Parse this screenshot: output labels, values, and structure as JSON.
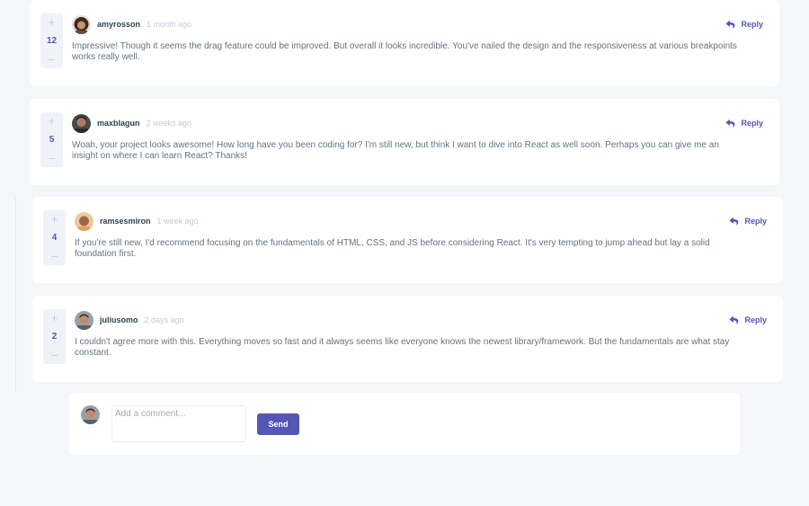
{
  "comments": [
    {
      "username": "amyrosson",
      "time": "1 month ago",
      "score": "12",
      "content": "Impressive! Though it seems the drag feature could be improved. But overall it looks incredible. You've nailed the design and the responsiveness at various breakpoints works really well.",
      "reply_label": "Reply"
    },
    {
      "username": "maxblagun",
      "time": "2 weeks ago",
      "score": "5",
      "content": "Woah, your project looks awesome! How long have you been coding for? I'm still new, but think I want to dive into React as well soon. Perhaps you can give me an insight on where I can learn React? Thanks!",
      "reply_label": "Reply"
    },
    {
      "username": "ramsesmiron",
      "time": "1 week ago",
      "score": "4",
      "content": "If you're still new, I'd recommend focusing on the fundamentals of HTML, CSS, and JS before considering React. It's very tempting to jump ahead but lay a solid foundation first.",
      "reply_label": "Reply"
    },
    {
      "username": "juliusomo",
      "time": "2 days ago",
      "score": "2",
      "content": "I couldn't agree more with this. Everything moves so fast and it always seems like everyone knows the newest library/framework. But the fundamentals are what stay constant.",
      "reply_label": "Reply"
    }
  ],
  "vote": {
    "plus": "+",
    "minus": "–"
  },
  "add_comment": {
    "placeholder": "Add a comment...",
    "send_label": "Send"
  },
  "colors": {
    "accent": "#5457b6",
    "background": "#f5f6fa",
    "text": "#67727e",
    "username": "#324152",
    "muted": "#c7c9d6"
  },
  "icons": [
    "plus-icon",
    "minus-icon",
    "reply-icon",
    "avatar"
  ]
}
